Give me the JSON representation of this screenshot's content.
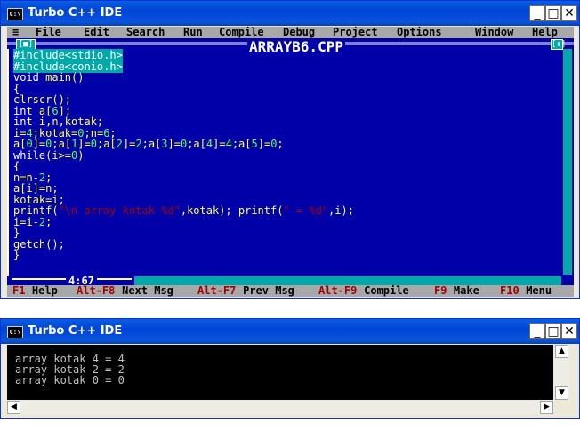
{
  "ide_window": {
    "title": "Turbo C++ IDE",
    "app_icon_text": "C:\\",
    "controls": {
      "minimize": "_",
      "maximize": "□",
      "close": "✕"
    },
    "menu": [
      {
        "label": "File"
      },
      {
        "label": "Edit"
      },
      {
        "label": "Search"
      },
      {
        "label": "Run"
      },
      {
        "label": "Compile"
      },
      {
        "label": "Debug"
      },
      {
        "label": "Project"
      },
      {
        "label": "Options"
      },
      {
        "label": "Window"
      },
      {
        "label": "Help"
      }
    ],
    "menu_system_glyph": "≡",
    "editor": {
      "filename": "ARRAYB6.CPP",
      "close_box": "[■]",
      "zoom_box": "[↕]",
      "cursor_position": "4:67",
      "lines": [
        [
          {
            "t": "#include<stdio.h>",
            "k": "pre"
          }
        ],
        [
          {
            "t": "#include<conio.h>",
            "k": "pre"
          }
        ],
        [
          {
            "t": "void ",
            "k": "kw"
          },
          {
            "t": "main",
            "k": "id"
          },
          {
            "t": "()",
            "k": "sym"
          }
        ],
        [
          {
            "t": "{",
            "k": "sym"
          }
        ],
        [
          {
            "t": "clrscr",
            "k": "id"
          },
          {
            "t": "();",
            "k": "sym"
          }
        ],
        [
          {
            "t": "int ",
            "k": "kw"
          },
          {
            "t": "a",
            "k": "id"
          },
          {
            "t": "[",
            "k": "sym"
          },
          {
            "t": "6",
            "k": "num"
          },
          {
            "t": "];",
            "k": "sym"
          }
        ],
        [
          {
            "t": "int ",
            "k": "kw"
          },
          {
            "t": "i,n,kotak;",
            "k": "id"
          }
        ],
        [
          {
            "t": "i=",
            "k": "id"
          },
          {
            "t": "4",
            "k": "num"
          },
          {
            "t": ";kotak=",
            "k": "id"
          },
          {
            "t": "0",
            "k": "num"
          },
          {
            "t": ";n=",
            "k": "id"
          },
          {
            "t": "6",
            "k": "num"
          },
          {
            "t": ";",
            "k": "sym"
          }
        ],
        [
          {
            "t": "a[",
            "k": "id"
          },
          {
            "t": "0",
            "k": "num"
          },
          {
            "t": "]=",
            "k": "id"
          },
          {
            "t": "0",
            "k": "num"
          },
          {
            "t": ";a[",
            "k": "id"
          },
          {
            "t": "1",
            "k": "num"
          },
          {
            "t": "]=",
            "k": "id"
          },
          {
            "t": "0",
            "k": "num"
          },
          {
            "t": ";a[",
            "k": "id"
          },
          {
            "t": "2",
            "k": "num"
          },
          {
            "t": "]=",
            "k": "id"
          },
          {
            "t": "2",
            "k": "num"
          },
          {
            "t": ";a[",
            "k": "id"
          },
          {
            "t": "3",
            "k": "num"
          },
          {
            "t": "]=",
            "k": "id"
          },
          {
            "t": "0",
            "k": "num"
          },
          {
            "t": ";a[",
            "k": "id"
          },
          {
            "t": "4",
            "k": "num"
          },
          {
            "t": "]=",
            "k": "id"
          },
          {
            "t": "4",
            "k": "num"
          },
          {
            "t": ";a[",
            "k": "id"
          },
          {
            "t": "5",
            "k": "num"
          },
          {
            "t": "]=",
            "k": "id"
          },
          {
            "t": "0",
            "k": "num"
          },
          {
            "t": ";",
            "k": "sym"
          }
        ],
        [
          {
            "t": "while",
            "k": "kw"
          },
          {
            "t": "(i>=",
            "k": "id"
          },
          {
            "t": "0",
            "k": "num"
          },
          {
            "t": ")",
            "k": "sym"
          }
        ],
        [
          {
            "t": "{",
            "k": "sym"
          }
        ],
        [
          {
            "t": "n=n-",
            "k": "id"
          },
          {
            "t": "2",
            "k": "num"
          },
          {
            "t": ";",
            "k": "sym"
          }
        ],
        [
          {
            "t": "a[i]=n;",
            "k": "id"
          }
        ],
        [
          {
            "t": "kotak=i;",
            "k": "id"
          }
        ],
        [
          {
            "t": "printf(",
            "k": "id"
          },
          {
            "t": "\"\\n array kotak %d\"",
            "k": "str"
          },
          {
            "t": ",kotak); printf(",
            "k": "id"
          },
          {
            "t": "\" = %d\"",
            "k": "str"
          },
          {
            "t": ",i);",
            "k": "id"
          }
        ],
        [
          {
            "t": "i=i-",
            "k": "id"
          },
          {
            "t": "2",
            "k": "num"
          },
          {
            "t": ";",
            "k": "sym"
          }
        ],
        [
          {
            "t": "}",
            "k": "sym"
          }
        ],
        [
          {
            "t": "getch",
            "k": "id"
          },
          {
            "t": "();",
            "k": "sym"
          }
        ],
        [
          {
            "t": "}",
            "k": "sym"
          }
        ]
      ]
    },
    "status": [
      {
        "key": "F1",
        "action": "Help"
      },
      {
        "key": "Alt-F8",
        "action": "Next Msg"
      },
      {
        "key": "Alt-F7",
        "action": "Prev Msg"
      },
      {
        "key": "Alt-F9",
        "action": "Compile"
      },
      {
        "key": "F9",
        "action": "Make"
      },
      {
        "key": "F10",
        "action": "Menu"
      }
    ]
  },
  "output_window": {
    "title": "Turbo C++ IDE",
    "app_icon_text": "C:\\",
    "controls": {
      "minimize": "_",
      "maximize": "□",
      "close": "✕"
    },
    "output_lines": [
      "array kotak 4 = 4",
      "array kotak 2 = 2",
      "array kotak 0 = 0"
    ]
  }
}
